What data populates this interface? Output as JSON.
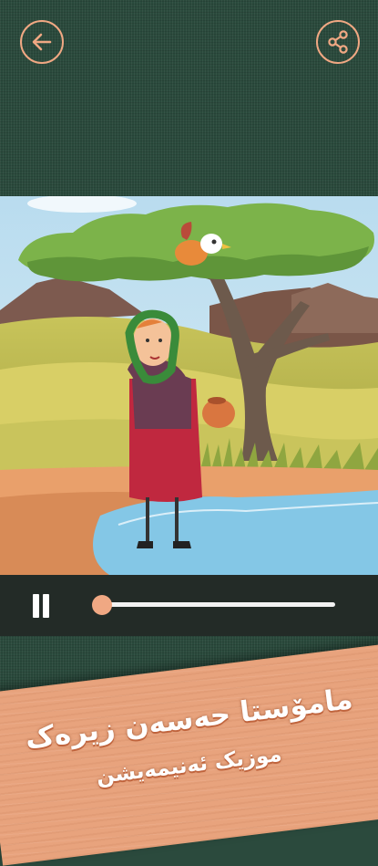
{
  "header": {
    "back_icon": "arrow-left-circle-icon",
    "share_icon": "share-icon",
    "accent_color": "#f0a883",
    "background_color": "#2a4a3c"
  },
  "video": {
    "scene": "cartoon-illustration",
    "state": "playing"
  },
  "player": {
    "pause_icon": "pause-icon",
    "progress_fraction": 0.01,
    "track_color": "#f2f2f2",
    "thumb_color": "#f0a883"
  },
  "banner": {
    "title": "مامۆستا حەسەن زیرەک",
    "subtitle": "موزیک ئەنیمەیشن",
    "color": "#e8a37d"
  }
}
